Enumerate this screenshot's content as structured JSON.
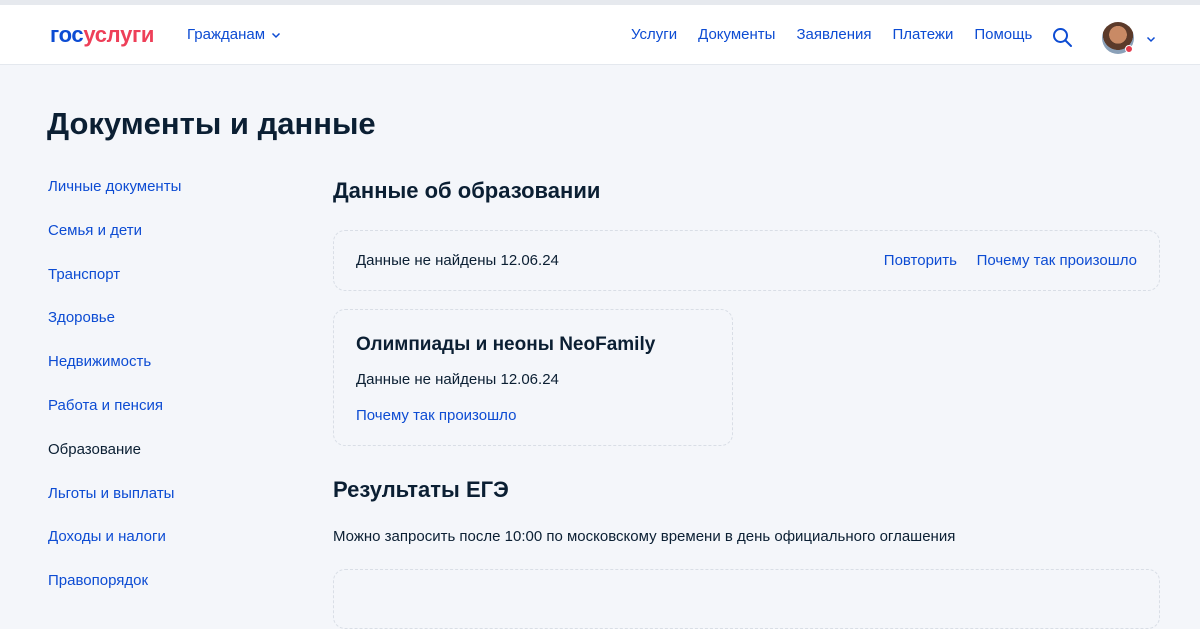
{
  "header": {
    "logo_part1": "гос",
    "logo_part2": "услуги",
    "audience": "Гражданам",
    "nav": [
      "Услуги",
      "Документы",
      "Заявления",
      "Платежи",
      "Помощь"
    ]
  },
  "page": {
    "title": "Документы и данные"
  },
  "sidebar": {
    "items": [
      "Личные документы",
      "Семья и дети",
      "Транспорт",
      "Здоровье",
      "Недвижимость",
      "Работа и пенсия",
      "Образование",
      "Льготы и выплаты",
      "Доходы и налоги",
      "Правопорядок"
    ],
    "active_index": 6
  },
  "education": {
    "title": "Данные об образовании",
    "status": "Данные не найдены 12.06.24",
    "retry_label": "Повторить",
    "why_label": "Почему так произошло"
  },
  "olympiads": {
    "title": "Олимпиады и неоны NeoFamily",
    "status": "Данные не найдены 12.06.24",
    "why_label": "Почему так произошло"
  },
  "ege": {
    "title": "Результаты ЕГЭ",
    "note": "Можно запросить после 10:00 по московскому времени в день официального оглашения"
  },
  "colors": {
    "link": "#0d4cd3",
    "brand_red": "#ee3f58",
    "text": "#0b1f33",
    "background": "#f4f6fa"
  }
}
